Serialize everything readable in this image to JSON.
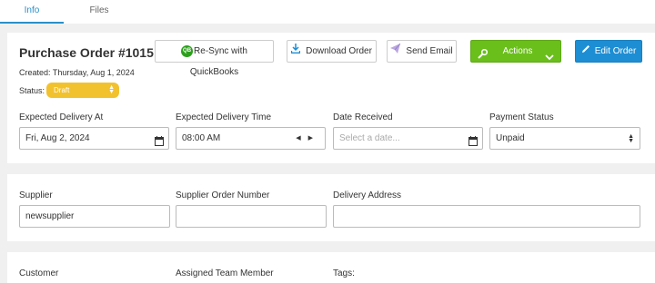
{
  "tabs": [
    {
      "label": "Info",
      "active": true
    },
    {
      "label": "Files",
      "active": false
    }
  ],
  "header": {
    "title": "Purchase Order #1015",
    "created": "Created: Thursday, Aug 1, 2024",
    "status_label": "Status:",
    "status_value": "Draft"
  },
  "toolbar": {
    "qb_icon_text": "QB",
    "resync_label": "Re-Sync with QuickBooks",
    "download_label": "Download Order",
    "email_label": "Send Email",
    "actions_label": "Actions",
    "edit_label": "Edit Order"
  },
  "delivery": {
    "expected_at_label": "Expected Delivery At",
    "expected_at_value": "Fri, Aug 2, 2024",
    "expected_time_label": "Expected Delivery Time",
    "expected_time_value": "08:00 AM",
    "received_label": "Date Received",
    "received_placeholder": "Select a date...",
    "payment_label": "Payment Status",
    "payment_value": "Unpaid"
  },
  "supplier": {
    "supplier_label": "Supplier",
    "supplier_value": "newsupplier",
    "order_number_label": "Supplier Order Number",
    "order_number_value": "",
    "address_label": "Delivery Address",
    "address_value": ""
  },
  "assignment": {
    "customer_label": "Customer",
    "team_member_label": "Assigned Team Member",
    "tags_label": "Tags:"
  },
  "colors": {
    "accent": "#2a8fc9",
    "actions_green": "#6abf1b",
    "edit_blue": "#1d8ed3",
    "status_yellow": "#f2c12e",
    "quickbooks_green": "#2ca01c"
  },
  "icons": {
    "qb": "quickbooks-icon",
    "download": "download-icon",
    "email": "send-email-icon",
    "actions": "wrench-icon",
    "edit": "pencil-icon",
    "calendar": "calendar-icon"
  }
}
